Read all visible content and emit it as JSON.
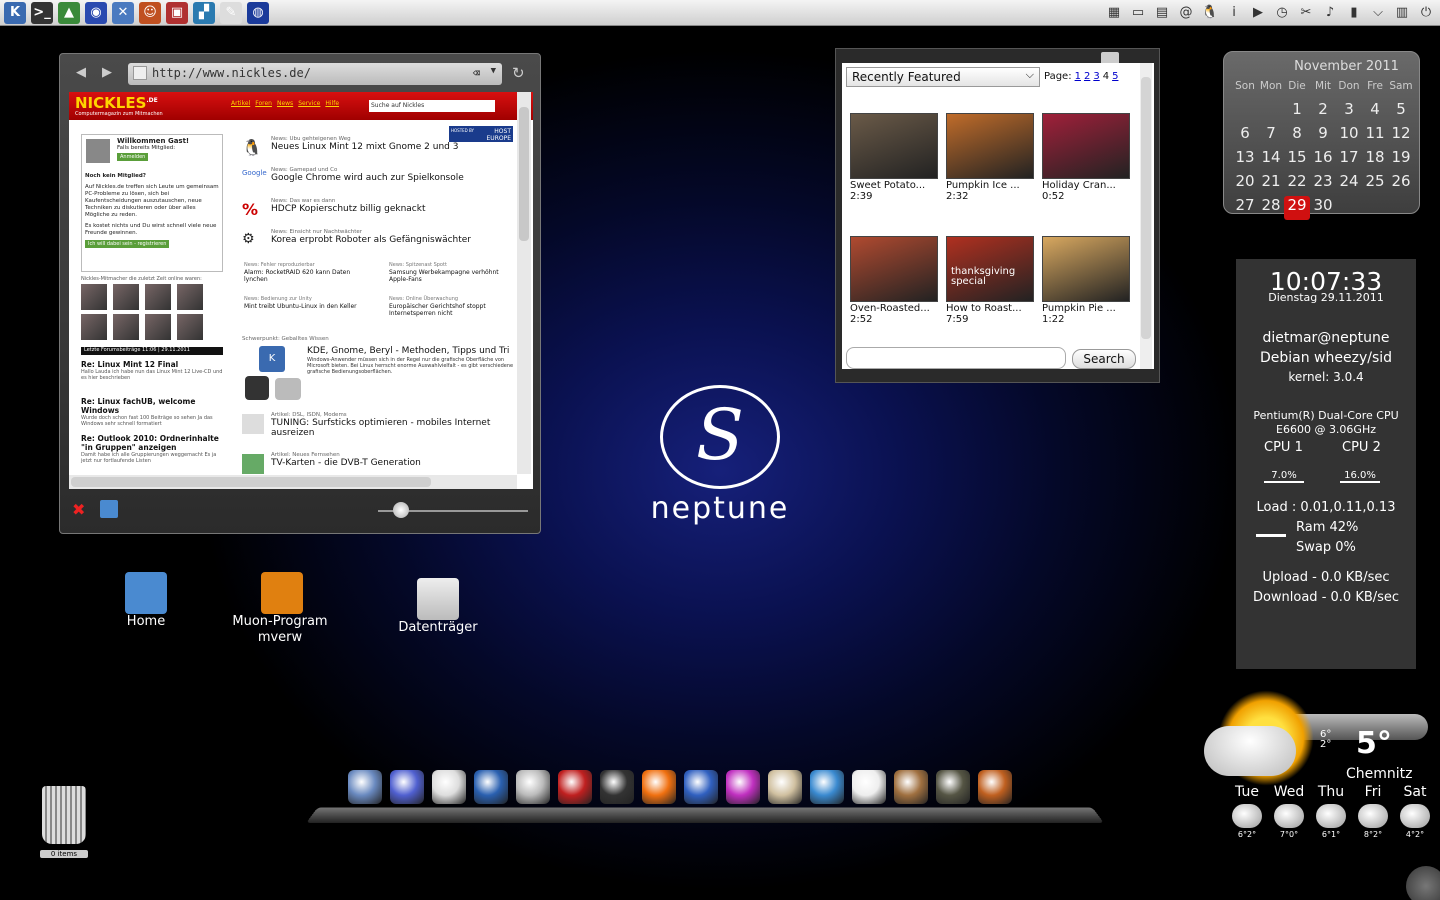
{
  "taskbar": {
    "left_icons": [
      "kde-menu-icon",
      "terminal-icon",
      "monitor-icon",
      "network-icon",
      "tools-icon",
      "animal-icon",
      "package-icon",
      "chart-icon",
      "notes-icon",
      "globe-icon"
    ],
    "right_icons": [
      "calculator-icon",
      "drive-icon",
      "calendar-icon",
      "mail-icon",
      "tux-icon",
      "info-icon",
      "play-icon",
      "clock-icon",
      "scissors-icon",
      "volume-icon",
      "battery-icon",
      "chevron-down-icon",
      "system-monitor-icon",
      "power-icon"
    ]
  },
  "browser": {
    "url": "http://www.nickles.de/",
    "site": {
      "logo": "NICKLES",
      "logo_tld": ".DE",
      "subtitle": "Computermagazin zum Mitmachen",
      "menu": [
        "Artikel",
        "Foren",
        "News",
        "Service",
        "Hilfe"
      ],
      "search_placeholder": "Suche auf Nickles",
      "welcome": "Willkommen Gast!",
      "already_member": "Falls bereits Mitglied:",
      "login_btn": "Anmelden",
      "not_member": "Noch kein Mitglied?",
      "intro": "Auf Nickles.de treffen sich Leute um gemeinsam PC-Probleme zu lösen, sich bei Kaufentscheidungen auszutauschen, neue Techniken zu diskutieren oder über alles Mögliche zu reden.",
      "free": "Es kostet nichts und Du wirst schnell viele neue Freunde gewinnen.",
      "join_btn": "Ich will dabei sein - registrieren",
      "members_caption": "Nickles-Mitmacher die zuletzt Zeit online waren:",
      "forum_header": "Letzte Forumsbeiträge 11:06 | 29.11.2011",
      "forum": [
        {
          "title": "Re: Linux Mint 12 Final",
          "text": "Hallo Lauda ich habe nun das Linux Mint 12 Live-CD und es hier beschrieben"
        },
        {
          "title": "Re: Linux fachUB, welcome Windows",
          "text": "Wurde doch schon fast 100 Beiträge so sehen Ja das Windows sehr schnell formatiert"
        },
        {
          "title": "Re: Outlook 2010: Ordnerinhalte \"in Gruppen\" anzeigen",
          "text": "Damit habe ich alle Gruppierungen weggemacht Es ja jetzt nur fortlaufende Listen"
        }
      ],
      "hosted": "HOST EUROPE",
      "hosted_by": "HOSTED BY",
      "news": [
        {
          "cat": "News: Ubu gehteigenen Weg",
          "hl": "Neues Linux Mint 12 mixt Gnome 2 und 3"
        },
        {
          "cat": "News: Gamepad und Co",
          "hl": "Google Chrome wird auch zur Spielkonsole"
        },
        {
          "cat": "News: Das war es dann",
          "hl": "HDCP Kopierschutz billig geknackt"
        },
        {
          "cat": "News: Einsicht nur Nachtwächter",
          "hl": "Korea erprobt Roboter als Gefängniswächter"
        }
      ],
      "small_news": [
        {
          "cat": "News: Fehler reproduzierbar",
          "hl": "Alarm: RocketRAID 620 kann Daten lynchen"
        },
        {
          "cat": "News: Spitzenast Spott",
          "hl": "Samsung Werbekampagne verhöhnt Apple-Fans"
        },
        {
          "cat": "News: Bedienung zur Unity",
          "hl": "Mint treibt Ubuntu-Linux in den Keller"
        },
        {
          "cat": "News: Online Überwachung",
          "hl": "Europäischer Gerichtshof stoppt Internetsperren nicht"
        }
      ],
      "focus_cat": "Schwerpunkt: Geballtes Wissen",
      "focus_hl": "KDE, Gnome, Beryl - Methoden, Tipps und Tri",
      "focus_text": "Windows-Anwender müssen sich in der Regel nur die grafische Oberfläche von Microsoft bieten. Bei Linux herrscht enorme Auswahlvielfalt - es gibt verschiedene grafische Bedienungsoberflächen.",
      "article1_cat": "Artikel: DSL, ISDN, Modems",
      "article1_hl": "TUNING: Surfsticks optimieren - mobiles Internet ausreizen",
      "article2_cat": "Artikel: Neues Fernsehen",
      "article2_hl": "TV-Karten - die DVB-T Generation"
    }
  },
  "video": {
    "dropdown": "Recently Featured",
    "page_label": "Page:",
    "pages": [
      "1",
      "2",
      "3",
      "4",
      "5"
    ],
    "current_page": "4",
    "thumbs": [
      {
        "title": "Sweet Potato...",
        "dur": "2:39",
        "color": "#6a5a48"
      },
      {
        "title": "Pumpkin Ice ...",
        "dur": "2:32",
        "color": "#c06c2a"
      },
      {
        "title": "Holiday Cran...",
        "dur": "0:52",
        "color": "#a0203a"
      },
      {
        "title": "Oven-Roasted...",
        "dur": "2:52",
        "color": "#b04a30"
      },
      {
        "title": "How to Roast...",
        "dur": "7:59",
        "color": "#b03020"
      },
      {
        "title": "Pumpkin Pie ...",
        "dur": "1:22",
        "color": "#d8a860"
      }
    ],
    "overlay_text": "thanksgiving special",
    "search_label": "Search"
  },
  "calendar": {
    "title": "November 2011",
    "days": [
      "Son",
      "Mon",
      "Die",
      "Mit",
      "Don",
      "Fre",
      "Sam"
    ],
    "offset": 2,
    "num_days": 30,
    "today": 29
  },
  "conky": {
    "time": "10:07:33",
    "date": "Dienstag 29.11.2011",
    "user": "dietmar@neptune",
    "os": "Debian wheezy/sid",
    "kernel": "kernel: 3.0.4",
    "cpu_model": "Pentium(R) Dual-Core  CPU      E6600  @ 3.06GHz",
    "cpu1_label": "CPU 1",
    "cpu2_label": "CPU 2",
    "cpu1_val": "7.0%",
    "cpu2_val": "16.0%",
    "load": "Load : 0.01,0.11,0.13",
    "ram": "Ram 42%",
    "swap": "Swap 0%",
    "upload": "Upload - 0.0 KB/sec",
    "download": "Download - 0.0 KB/sec"
  },
  "weather": {
    "high": "6°",
    "low": "2°",
    "temp": "5°",
    "city": "Chemnitz",
    "days": [
      {
        "name": "Tue",
        "temps": "6°2°"
      },
      {
        "name": "Wed",
        "temps": "7°0°"
      },
      {
        "name": "Thu",
        "temps": "6°1°"
      },
      {
        "name": "Fri",
        "temps": "8°2°"
      },
      {
        "name": "Sat",
        "temps": "4°2°"
      }
    ]
  },
  "logo": {
    "glyph": "S",
    "text": "neptune"
  },
  "desktop_icons": [
    {
      "name": "home-icon",
      "label": "Home",
      "color": "#4a8ad0"
    },
    {
      "name": "muon-icon",
      "label": "Muon-Programmverw",
      "color": "#e08010"
    },
    {
      "name": "drive-icon",
      "label": "Datenträger",
      "color": "#ddd"
    }
  ],
  "dock": {
    "items": [
      {
        "name": "chromium-icon",
        "color": "#6a8ac0"
      },
      {
        "name": "network-globe-icon",
        "color": "#5060d0"
      },
      {
        "name": "mail-stamp-icon",
        "color": "#ddd"
      },
      {
        "name": "google-earth-icon",
        "color": "#2a60b0"
      },
      {
        "name": "compass-icon",
        "color": "#bbb"
      },
      {
        "name": "alarm-icon",
        "color": "#c02020"
      },
      {
        "name": "clapperboard-icon",
        "color": "#333"
      },
      {
        "name": "vlc-icon",
        "color": "#f07010"
      },
      {
        "name": "wolf-browser-icon",
        "color": "#3060c0"
      },
      {
        "name": "eye-icon",
        "color": "#c030c0"
      },
      {
        "name": "photos-icon",
        "color": "#d0c0a0"
      },
      {
        "name": "dictionary-icon",
        "color": "#3a8ad0"
      },
      {
        "name": "writer-icon",
        "color": "#eee"
      },
      {
        "name": "chess-board-icon",
        "color": "#a07040"
      },
      {
        "name": "chess-pieces-icon",
        "color": "#554"
      },
      {
        "name": "screen-icon",
        "color": "#c06020"
      }
    ]
  },
  "trash": {
    "label": "0 items"
  }
}
